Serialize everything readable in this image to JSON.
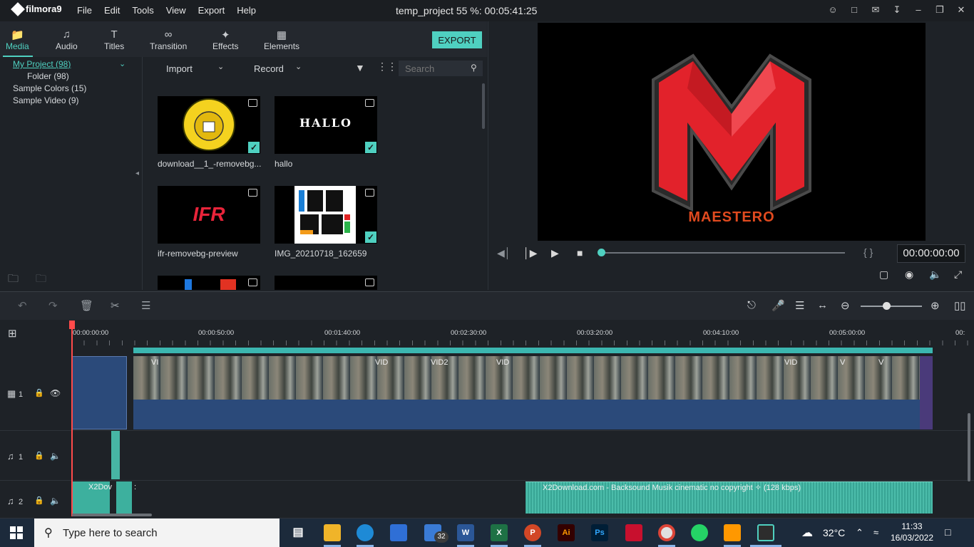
{
  "app": {
    "name": "filmora9",
    "project_title": "temp_project 55 %:  00:05:41:25"
  },
  "menu": [
    "File",
    "Edit",
    "Tools",
    "View",
    "Export",
    "Help"
  ],
  "window_icons": [
    "account-icon",
    "save-icon",
    "mail-icon",
    "download-icon",
    "minimize-icon",
    "restore-icon",
    "close-icon"
  ],
  "tabs": [
    {
      "label": "Media",
      "icon": "folder-icon",
      "active": true
    },
    {
      "label": "Audio",
      "icon": "music-note-icon"
    },
    {
      "label": "Titles",
      "icon": "text-icon"
    },
    {
      "label": "Transition",
      "icon": "transition-icon"
    },
    {
      "label": "Effects",
      "icon": "effects-icon"
    },
    {
      "label": "Elements",
      "icon": "image-icon"
    }
  ],
  "export_label": "EXPORT",
  "folders": [
    "My Project (98)",
    "Folder (98)",
    "Sample Colors (15)",
    "Sample Video (9)"
  ],
  "media_toolbar": {
    "import": "Import",
    "record": "Record",
    "search_placeholder": "Search"
  },
  "clips": [
    {
      "name": "download__1_-removebg...",
      "checked": true
    },
    {
      "name": "hallo",
      "checked": true,
      "thumb_text": "HALLO"
    },
    {
      "name": "ifr-removebg-preview",
      "checked": false,
      "thumb_text": "IFR"
    },
    {
      "name": "IMG_20210718_162659",
      "checked": true
    },
    {
      "name": "",
      "checked": false
    },
    {
      "name": "",
      "checked": false
    }
  ],
  "preview": {
    "logo_caption": "MAESTERO",
    "timecode": "00:00:00:00",
    "brackets": "{   }"
  },
  "timeline": {
    "ruler": [
      "00:00:00:00",
      "00:00:50:00",
      "00:01:40:00",
      "00:02:30:00",
      "00:03:20:00",
      "00:04:10:00",
      "00:05:00:00",
      "00:"
    ],
    "tracks": [
      {
        "label": "1",
        "type": "video"
      },
      {
        "label": "1",
        "type": "audio"
      },
      {
        "label": "2",
        "type": "audio"
      }
    ],
    "audio_clips": {
      "a": "X2Dov",
      "b": ":",
      "c": "X2Download.com - Backsound Musik cinematic no copyright ✧ (128 kbps)"
    },
    "video_labels": [
      "VI",
      "VID",
      "VID2",
      "VID",
      "VID",
      "V",
      "V"
    ]
  },
  "taskbar": {
    "search_placeholder": "Type here to search",
    "mail_badge": "32",
    "weather": "32°C",
    "time": "11:33",
    "date": "16/03/2022",
    "apps": [
      {
        "name": "task-view",
        "label": ""
      },
      {
        "name": "file-explorer",
        "label": ""
      },
      {
        "name": "edge",
        "label": ""
      },
      {
        "name": "store",
        "label": ""
      },
      {
        "name": "mail",
        "label": ""
      },
      {
        "name": "word",
        "label": "W"
      },
      {
        "name": "excel",
        "label": "X"
      },
      {
        "name": "powerpoint",
        "label": "P"
      },
      {
        "name": "illustrator",
        "label": "Ai"
      },
      {
        "name": "photoshop",
        "label": "Ps"
      },
      {
        "name": "sketchup",
        "label": ""
      },
      {
        "name": "chrome",
        "label": ""
      },
      {
        "name": "whatsapp",
        "label": ""
      },
      {
        "name": "sublime",
        "label": ""
      },
      {
        "name": "filmora",
        "label": ""
      }
    ]
  }
}
